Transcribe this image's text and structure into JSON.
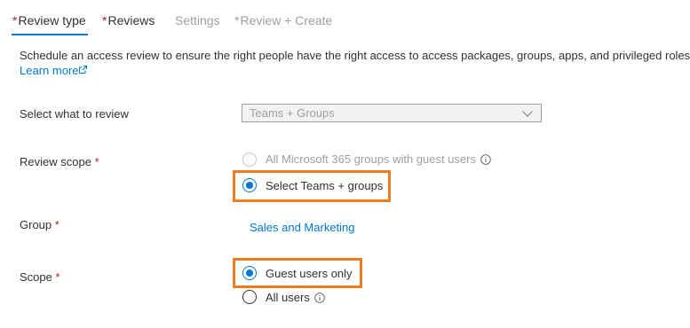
{
  "tabs": [
    {
      "required": "*",
      "label": "Review type",
      "state": "active"
    },
    {
      "required": "*",
      "label": "Reviews",
      "state": "normal"
    },
    {
      "required": "",
      "label": "Settings",
      "state": "disabled"
    },
    {
      "required": "*",
      "label": "Review + Create",
      "state": "disabled"
    }
  ],
  "description": {
    "text": "Schedule an access review to ensure the right people have the right access to access packages, groups, apps, and privileged roles.",
    "learn_more": "Learn more"
  },
  "form": {
    "select_what": {
      "label": "Select what to review",
      "value": "Teams + Groups"
    },
    "review_scope": {
      "label": "Review scope",
      "required": "*",
      "options": [
        {
          "label": "All Microsoft 365 groups with guest users",
          "selected": false,
          "disabled": true
        },
        {
          "label": "Select Teams + groups",
          "selected": true,
          "disabled": false
        }
      ]
    },
    "group": {
      "label": "Group",
      "required": "*",
      "value": "Sales and Marketing"
    },
    "scope": {
      "label": "Scope",
      "required": "*",
      "options": [
        {
          "label": "Guest users only",
          "selected": true
        },
        {
          "label": "All users",
          "selected": false
        }
      ]
    }
  },
  "colors": {
    "accent": "#0078d4",
    "highlight": "#f07c21",
    "required": "#a4262c",
    "disabled": "#a19f9d"
  },
  "icons": [
    "external-link-icon",
    "chevron-down-icon",
    "info-icon"
  ]
}
